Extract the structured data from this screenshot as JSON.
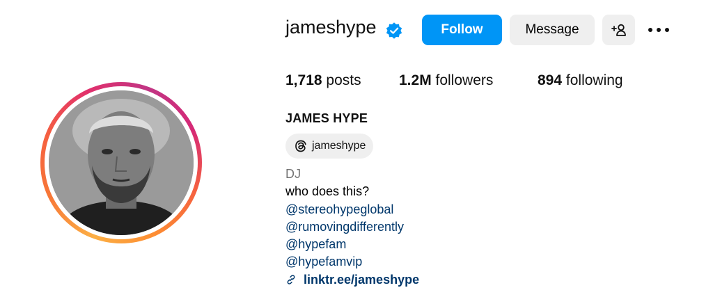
{
  "profile": {
    "username": "jameshype",
    "follow_label": "Follow",
    "message_label": "Message",
    "full_name": "JAMES HYPE",
    "threads_handle": "jameshype"
  },
  "stats": {
    "posts_count": "1,718",
    "posts_label": "posts",
    "followers_count": "1.2M",
    "followers_label": "followers",
    "following_count": "894",
    "following_label": "following"
  },
  "bio": {
    "category": "DJ",
    "text": "who does this?",
    "mentions": [
      "@stereohypeglobal",
      "@rumovingdifferently",
      "@hypefam",
      "@hypefamvip"
    ],
    "link": "linktr.ee/jameshype"
  },
  "icons": {
    "verified": "verified-badge-icon",
    "suggest": "add-person-icon",
    "more": "more-options-icon",
    "threads": "threads-icon",
    "link": "link-icon"
  },
  "colors": {
    "primary_button": "#0095f6",
    "secondary_button": "#efefef",
    "link": "#00376b",
    "verified": "#0095f6",
    "muted": "#737373"
  }
}
